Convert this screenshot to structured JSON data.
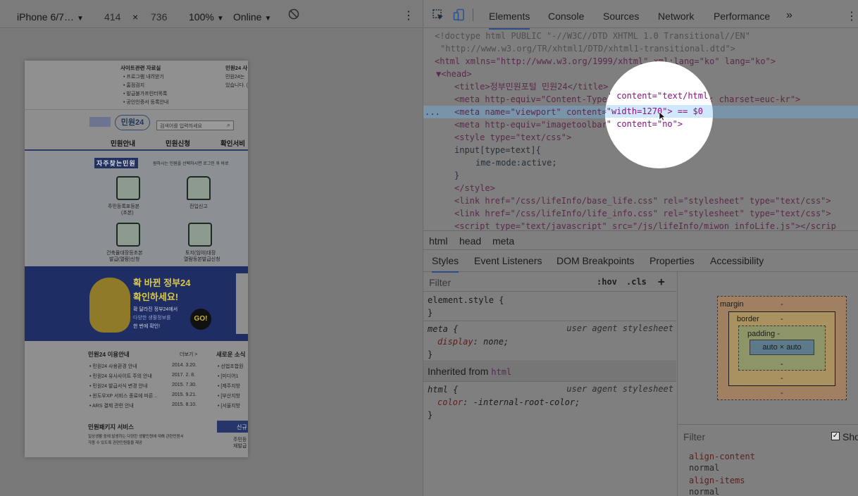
{
  "device_toolbar": {
    "device": "iPhone 6/7…",
    "width": "414",
    "times": "×",
    "height": "736",
    "zoom": "100%",
    "throttle": "Online"
  },
  "page": {
    "top_left_title": "사이트관련 자료실",
    "top_left_items": [
      "• 프로그램 내려받기",
      "• 홈점검지",
      "• 발급불가프린터목록",
      "• 공인인증서 등록안내"
    ],
    "top_right_title": "민원24 사",
    "top_right_items": [
      "민원24는 ",
      "있습니다. ("
    ],
    "logo": "민원24",
    "search_placeholder": "검색어를 입력하세요",
    "nav": [
      "민원안내",
      "민원신청",
      "확인서비"
    ],
    "frequent_label": "자주찾는민원",
    "frequent_desc": "원하시는 민원을 선택하시면 로그인 후 바로",
    "services": [
      {
        "label": "주민등록표등본",
        "sub": "(초본)"
      },
      {
        "label": "전입신고",
        "sub": ""
      },
      {
        "label": "건축물대장등초본",
        "sub": "발급(열람)신청"
      },
      {
        "label": "토지(임야)대장",
        "sub": "열람등본발급신청"
      }
    ],
    "banner": {
      "line1": "확 바뀐 정부24",
      "line2": "확인하세요!",
      "line3": "확 달라진 정부24에서",
      "line4": "다양한 생활정보를",
      "line5": "한 번에 확인!",
      "go": "GO!"
    },
    "notice_title": "민원24 이용안내",
    "notice_more": "더보기 >",
    "news_title": "새로운 소식",
    "notices": [
      {
        "text": "• 민원24 사용환경 안내",
        "date": "2014. 3.20."
      },
      {
        "text": "• 민원24 유사사이트 주의 안내",
        "date": "2017. 2. 8."
      },
      {
        "text": "• 민원24 발급서식 변경 안내",
        "date": "2015. 7.30."
      },
      {
        "text": "• 윈도우XP 서비스 종료에 따른 ..",
        "date": "2015. 9.21."
      },
      {
        "text": "• ARS 결제 관련 안내",
        "date": "2015. 8.10."
      }
    ],
    "news": [
      "• 선법조합원",
      "• [미디어1 ",
      "• [제주지방",
      "• [부산지방",
      "• [서울지방"
    ],
    "package_title": "민원패키지 서비스",
    "package_desc1": "일상생활 중에 발생하는 다양한 생활민원에 대해 관련민원서",
    "package_desc2": "각종 수 있도록 관련민원들을 제공",
    "new_btn": "신규",
    "resident_btn1": "주민등",
    "resident_btn2": "재발급"
  },
  "devtools": {
    "tabs": [
      "Elements",
      "Console",
      "Sources",
      "Network",
      "Performance"
    ],
    "more": "»",
    "source": {
      "doctype1": "<!doctype html PUBLIC \"-//W3C//DTD XHTML 1.0 Transitional//EN\"",
      "doctype2": "\"http://www.w3.org/TR/xhtml1/DTD/xhtml1-transitional.dtd\">",
      "html_open": "<html xmlns=\"http://www.w3.org/1999/xhtml\" xml:lang=\"ko\" lang=\"ko\">",
      "head_open": "▼<head>",
      "title": "<title>정부민원포털 민원24</title>",
      "meta1": "<meta http-equiv=\"Content-Type\" content=\"text/html; charset=euc-kr\">",
      "meta_viewport": "<meta name=\"viewport\" content=\"width=1270\"> == $0",
      "meta3": "<meta http-equiv=\"imagetoolbar\" content=\"no\">",
      "style_open": "<style type=\"text/css\">",
      "style_rule1": "input[type=text]{",
      "style_rule2": "ime-mode:active;",
      "style_rule3": "}",
      "style_close": "</style>",
      "link1": "<link href=\"/css/lifeInfo/base_life.css\" rel=\"stylesheet\" type=\"text/css\">",
      "link2": "<link href=\"/css/lifeInfo/life_info.css\" rel=\"stylesheet\" type=\"text/css\">",
      "script": "<script type=\"text/javascript\" src=\"/js/lifeInfo/miwon_infoLife.js\"></scrip",
      "ellipsis": "..."
    },
    "breadcrumbs": [
      "html",
      "head",
      "meta"
    ],
    "subtabs": [
      "Styles",
      "Event Listeners",
      "DOM Breakpoints",
      "Properties",
      "Accessibility"
    ],
    "styles": {
      "filter": "Filter",
      "hov": ":hov",
      "cls": ".cls",
      "plus": "+",
      "element_style": "element.style {",
      "close": "}",
      "meta_sel": "meta {",
      "ua": "user agent stylesheet",
      "display_prop": "display",
      "display_val": "none;",
      "inherited": "Inherited from",
      "inherited_tag": "html",
      "html_sel": "html {",
      "color_prop": "color",
      "color_val": "-internal-root-color;"
    },
    "box_model": {
      "margin": "margin",
      "border": "border",
      "padding": "padding -",
      "content": "auto × auto",
      "dash": "-"
    },
    "computed": {
      "filter": "Filter",
      "show": "Sho",
      "props": [
        {
          "name": "align-content",
          "value": "normal"
        },
        {
          "name": "align-items",
          "value": "normal"
        }
      ]
    }
  }
}
